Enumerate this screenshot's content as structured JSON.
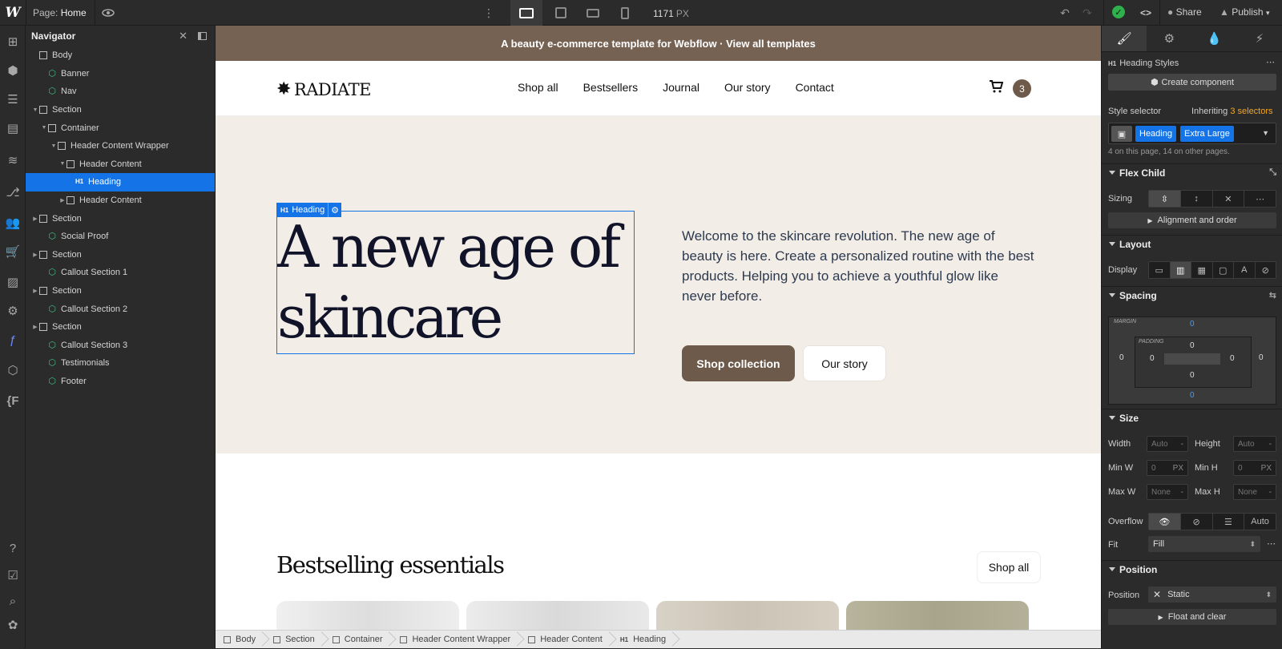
{
  "topbar": {
    "logo": "W",
    "page_label": "Page:",
    "page_name": "Home",
    "width_value": "1171",
    "width_unit": "PX",
    "share": "Share",
    "publish": "Publish"
  },
  "navigator": {
    "title": "Navigator",
    "items": [
      {
        "label": "Body"
      },
      {
        "label": "Banner"
      },
      {
        "label": "Nav"
      },
      {
        "label": "Section"
      },
      {
        "label": "Container"
      },
      {
        "label": "Header Content Wrapper"
      },
      {
        "label": "Header Content"
      },
      {
        "label": "Heading"
      },
      {
        "label": "Header Content"
      },
      {
        "label": "Section"
      },
      {
        "label": "Social Proof"
      },
      {
        "label": "Section"
      },
      {
        "label": "Callout Section 1"
      },
      {
        "label": "Section"
      },
      {
        "label": "Callout Section 2"
      },
      {
        "label": "Section"
      },
      {
        "label": "Callout Section 3"
      },
      {
        "label": "Testimonials"
      },
      {
        "label": "Footer"
      }
    ]
  },
  "site": {
    "banner": "A beauty e-commerce template for Webflow · View all templates",
    "brand": "RADIATE",
    "menu": [
      "Shop all",
      "Bestsellers",
      "Journal",
      "Our story",
      "Contact"
    ],
    "cart_count": "3",
    "hero_heading": "A new age of\nskincare",
    "selection_tag": "Heading",
    "selection_tag_prefix": "H1",
    "hero_text": "Welcome to the skincare revolution. The new age of beauty is here. Create a personalized routine with the best products. Helping you to achieve a youthful glow like never before.",
    "btn_shop": "Shop collection",
    "btn_story": "Our story",
    "section_title": "Bestselling essentials",
    "btn_shop_all": "Shop all"
  },
  "breadcrumbs": [
    "Body",
    "Section",
    "Container",
    "Header Content Wrapper",
    "Header Content",
    "Heading"
  ],
  "panel": {
    "element_type": "H1",
    "element_label": "Heading Styles",
    "create_component": "Create component",
    "style_selector": "Style selector",
    "inheriting_prefix": "Inheriting",
    "inheriting_count": "3 selectors",
    "selector_tokens": [
      "Heading",
      "Extra Large"
    ],
    "usage": "4 on this page, 14 on other pages.",
    "flex_child": "Flex Child",
    "sizing": "Sizing",
    "align_order": "Alignment and order",
    "layout": "Layout",
    "display": "Display",
    "spacing": "Spacing",
    "margin_label": "MARGIN",
    "padding_label": "PADDING",
    "margin": {
      "top": "0",
      "right": "0",
      "bottom": "0",
      "left": "0"
    },
    "padding": {
      "top": "0",
      "right": "0",
      "bottom": "0",
      "left": "0"
    },
    "size": "Size",
    "width": "Width",
    "height": "Height",
    "min_w": "Min W",
    "min_h": "Min H",
    "max_w": "Max W",
    "max_h": "Max H",
    "auto": "Auto",
    "zero": "0",
    "px": "PX",
    "none": "None",
    "dash": "-",
    "overflow": "Overflow",
    "overflow_auto": "Auto",
    "fit": "Fit",
    "fit_value": "Fill",
    "position_section": "Position",
    "position": "Position",
    "position_value": "Static",
    "float_clear": "Float and clear"
  },
  "colors": {
    "accent": "#1473e6",
    "brand_brown": "#6e5a4a",
    "banner_brown": "#766253",
    "hero_bg": "#f3ede8",
    "orange": "#f5a623",
    "success": "#2fb04c"
  }
}
